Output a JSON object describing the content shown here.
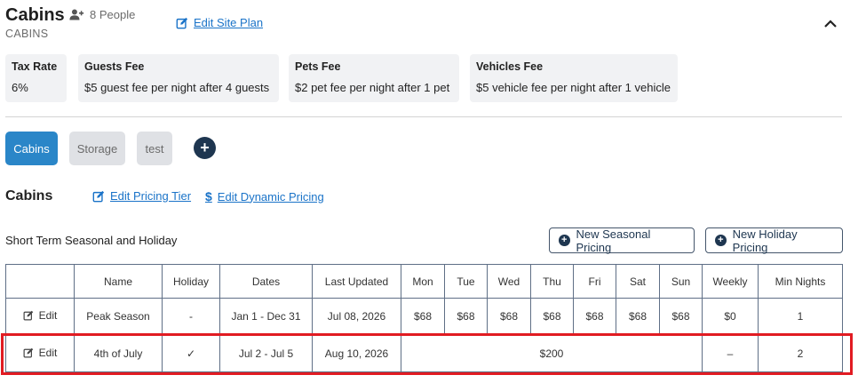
{
  "header": {
    "title": "Cabins",
    "people": "8 People",
    "subtitle": "CABINS",
    "edit_site_plan": "Edit Site Plan"
  },
  "fees": [
    {
      "label": "Tax Rate",
      "value": "6%"
    },
    {
      "label": "Guests Fee",
      "value": "$5 guest fee per night after 4 guests"
    },
    {
      "label": "Pets Fee",
      "value": "$2 pet fee per night after 1 pet"
    },
    {
      "label": "Vehicles Fee",
      "value": "$5 vehicle fee per night after 1 vehicle"
    }
  ],
  "tabs": [
    "Cabins",
    "Storage",
    "test"
  ],
  "add_tab_symbol": "+",
  "section": {
    "title": "Cabins",
    "edit_pricing_tier": "Edit Pricing Tier",
    "edit_dynamic_pricing": "Edit Dynamic Pricing",
    "dollar_symbol": "$"
  },
  "table": {
    "caption": "Short Term Seasonal and Holiday",
    "new_seasonal": "New Seasonal Pricing",
    "new_holiday": "New Holiday Pricing",
    "headers": [
      "",
      "Name",
      "Holiday",
      "Dates",
      "Last Updated",
      "Mon",
      "Tue",
      "Wed",
      "Thu",
      "Fri",
      "Sat",
      "Sun",
      "Weekly",
      "Min Nights"
    ],
    "rows": [
      {
        "edit": "Edit",
        "name": "Peak Season",
        "holiday": "-",
        "dates": "Jan 1 - Dec 31",
        "updated": "Jul 08, 2026",
        "mon": "$68",
        "tue": "$68",
        "wed": "$68",
        "thu": "$68",
        "fri": "$68",
        "sat": "$68",
        "sun": "$68",
        "weekly": "$0",
        "min_nights": "1"
      },
      {
        "edit": "Edit",
        "name": "4th of July",
        "holiday": "✓",
        "dates": "Jul 2 - Jul 5",
        "updated": "Aug 10, 2026",
        "flat_rate": "$200",
        "weekly": "–",
        "min_nights": "2"
      }
    ]
  },
  "colors": {
    "primary": "#2a86c8",
    "dark": "#1e3650",
    "link": "#1a73c8",
    "highlight": "#e11b22"
  }
}
